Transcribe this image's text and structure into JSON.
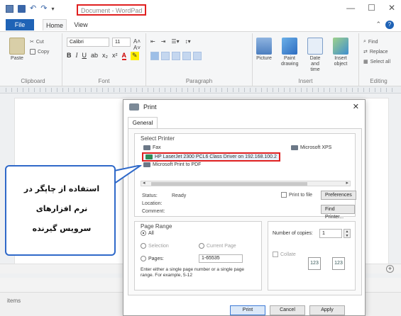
{
  "window": {
    "title": "Document - WordPad",
    "controls": [
      "—",
      "☐",
      "✕"
    ]
  },
  "tabs": {
    "file": "File",
    "home": "Home",
    "view": "View"
  },
  "ribbon": {
    "clipboard": {
      "label": "Clipboard",
      "paste": "Paste",
      "cut": "Cut",
      "copy": "Copy"
    },
    "font": {
      "label": "Font",
      "family": "Calibri",
      "size": "11"
    },
    "paragraph": {
      "label": "Paragraph"
    },
    "insert": {
      "label": "Insert",
      "picture": "Picture",
      "paint": "Paint drawing",
      "datetime": "Date and time",
      "object": "Insert object"
    },
    "editing": {
      "label": "Editing",
      "find": "Find",
      "replace": "Replace",
      "select_all": "Select all"
    }
  },
  "status": {
    "text": "items"
  },
  "dialog": {
    "title": "Print",
    "close": "✕",
    "tab": "General",
    "select_printer": "Select Printer",
    "printers": {
      "fax": "Fax",
      "hp": "HP LaserJet 2300 PCL6 Class Driver on 192.168.100.2",
      "pdf": "Microsoft Print to PDF",
      "xps": "Microsoft XPS"
    },
    "info": {
      "status_key": "Status:",
      "status_val": "Ready",
      "location_key": "Location:",
      "comment_key": "Comment:"
    },
    "print_to_file": "Print to file",
    "preferences": "Preferences",
    "find_printer": "Find Printer...",
    "page_range": {
      "label": "Page Range",
      "all": "All",
      "selection": "Selection",
      "current": "Current Page",
      "pages": "Pages:",
      "pages_value": "1-65535",
      "hint": "Enter either a single page number or a single page range. For example, 5-12"
    },
    "copies": {
      "label": "Number of copies:",
      "value": "1",
      "collate": "Collate",
      "stack_a": "123",
      "stack_b": "123"
    },
    "buttons": {
      "print": "Print",
      "cancel": "Cancel",
      "apply": "Apply"
    }
  },
  "callout": {
    "line1": "استفاده از چاپگر در",
    "line2": "نرم افزارهای",
    "line3": "سرویس گیرنده"
  },
  "colors": {
    "accent": "#1f63b6",
    "highlight_box": "#e02020",
    "callout_border": "#2f69c9"
  }
}
